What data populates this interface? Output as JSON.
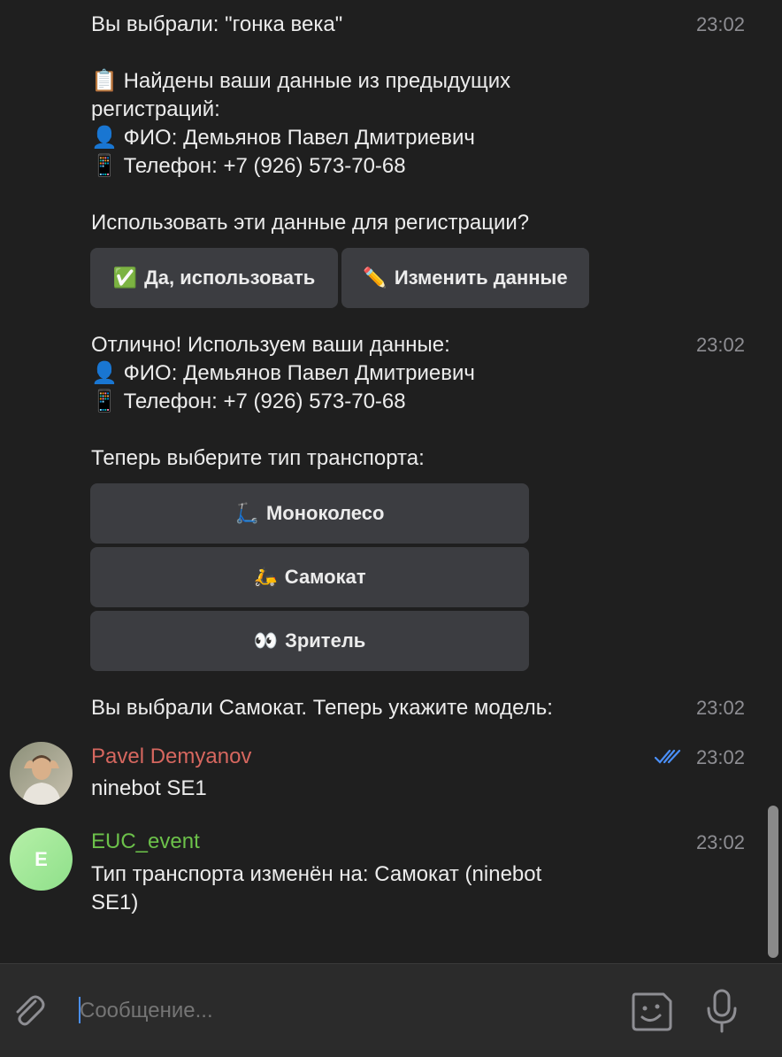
{
  "messages": {
    "m1": {
      "line1": "Вы выбрали: \"гонка века\"",
      "time": "23:02",
      "found_emoji": "📋",
      "found_line1": "Найдены ваши данные из предыдущих",
      "found_line2": "регистраций:",
      "fio_emoji": "👤",
      "fio": "ФИО: Демьянов Павел Дмитриевич",
      "phone_emoji": "📱",
      "phone": "Телефон: +7 (926) 573-70-68",
      "question": "Использовать эти данные для регистрации?",
      "btn_use_emoji": "✅",
      "btn_use": "Да, использовать",
      "btn_edit_emoji": "✏️",
      "btn_edit": "Изменить данные"
    },
    "m2": {
      "line1": "Отлично! Используем ваши данные:",
      "time": "23:02",
      "fio_emoji": "👤",
      "fio": "ФИО: Демьянов Павел Дмитриевич",
      "phone_emoji": "📱",
      "phone": "Телефон: +7 (926) 573-70-68",
      "prompt": "Теперь выберите тип транспорта:",
      "options": [
        {
          "emoji": "🛴",
          "label": "Моноколесо"
        },
        {
          "emoji": "🛵",
          "label": "Самокат"
        },
        {
          "emoji": "👀",
          "label": "Зритель"
        }
      ]
    },
    "m3": {
      "text": "Вы выбрали Самокат. Теперь укажите модель:",
      "time": "23:02"
    },
    "m4": {
      "sender": "Pavel Demyanov",
      "sender_color": "#d6675f",
      "text": "ninebot SE1",
      "time": "23:02",
      "read_icon": "double-check-icon"
    },
    "m5": {
      "sender": "EUC_event",
      "sender_color": "#6cc14a",
      "avatar_letter": "E",
      "line1": "Тип транспорта изменён на: Самокат (ninebot",
      "line2": "SE1)",
      "time": "23:02"
    }
  },
  "composer": {
    "placeholder": "Сообщение...",
    "attach_icon": "paperclip-icon",
    "sticker_icon": "sticker-icon",
    "mic_icon": "microphone-icon"
  }
}
